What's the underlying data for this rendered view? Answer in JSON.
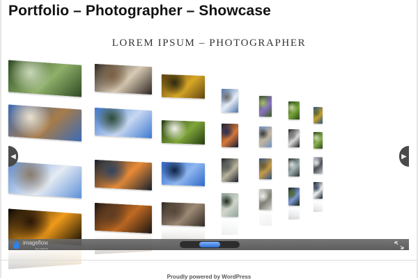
{
  "page": {
    "title": "Portfolio – Photographer – Showcase"
  },
  "gallery": {
    "heading": "LOREM IPSUM – PHOTOGRAPHER",
    "photos": [
      {
        "name": "photo-water-moss",
        "colors": [
          "#2e4a22",
          "#8fb06a",
          "#c9d7b9"
        ]
      },
      {
        "name": "photo-windmill-barn",
        "colors": [
          "#3a6bb8",
          "#a77c4a",
          "#e9e1cf"
        ]
      },
      {
        "name": "photo-winter-church-tower",
        "colors": [
          "#5d8fd7",
          "#e5ebf3",
          "#8a7b6a"
        ]
      },
      {
        "name": "photo-black-orange-circle",
        "colors": [
          "#050505",
          "#f09b1a",
          "#2a1708"
        ]
      },
      {
        "name": "photo-arch-window",
        "colors": [
          "#2b2420",
          "#d8cab3",
          "#7a5f42"
        ]
      },
      {
        "name": "photo-blue-sky-tree",
        "colors": [
          "#3d78d0",
          "#c7d8f1",
          "#2f4a35"
        ]
      },
      {
        "name": "photo-dusk-tree",
        "colors": [
          "#14202e",
          "#e98b37",
          "#31445f"
        ]
      },
      {
        "name": "photo-cafe-chairs",
        "colors": [
          "#191512",
          "#c06a22",
          "#5c3b24"
        ]
      },
      {
        "name": "photo-golden-leaves",
        "colors": [
          "#5f4310",
          "#d7a727",
          "#2d280f"
        ]
      },
      {
        "name": "photo-white-flower-green",
        "colors": [
          "#243b12",
          "#7fa63a",
          "#f2f2ea"
        ]
      },
      {
        "name": "photo-blue-sky-square",
        "colors": [
          "#2d67c8",
          "#8fb7ef",
          "#0f2240"
        ]
      },
      {
        "name": "photo-rock-wall",
        "colors": [
          "#2f2822",
          "#9d8a75",
          "#574639"
        ]
      },
      {
        "name": "photo-snow-branches",
        "colors": [
          "#4e72a8",
          "#e6edf6",
          "#6a6a6a"
        ]
      },
      {
        "name": "photo-night-orange-sky",
        "colors": [
          "#141b33",
          "#d7793a",
          "#2a2d55"
        ]
      },
      {
        "name": "photo-parasol-sunset",
        "colors": [
          "#1b2128",
          "#b9b39d",
          "#5a5e5c"
        ]
      },
      {
        "name": "photo-bare-branch-sky",
        "colors": [
          "#8fa39a",
          "#cfd6c9",
          "#1f2a1d"
        ]
      },
      {
        "name": "photo-purple-flowers",
        "colors": [
          "#3c5e19",
          "#8a73c6",
          "#a3c061"
        ]
      },
      {
        "name": "photo-stone-tower",
        "colors": [
          "#6e91c6",
          "#c2b59c",
          "#3c3a34"
        ]
      },
      {
        "name": "photo-reeds-autumn",
        "colors": [
          "#2f4f83",
          "#c59b46",
          "#6c5a2f"
        ]
      },
      {
        "name": "photo-white-birch",
        "colors": [
          "#d4d4d1",
          "#7f7f76",
          "#efefeb"
        ]
      },
      {
        "name": "photo-green-meadow",
        "colors": [
          "#2c4718",
          "#76a53a",
          "#cbd7a2"
        ]
      },
      {
        "name": "photo-people-silhouettes",
        "colors": [
          "#1d1d1d",
          "#dbdbdb",
          "#7d7d7d"
        ]
      },
      {
        "name": "photo-hazy-valley",
        "colors": [
          "#2a3431",
          "#9dadae",
          "#dfe1df"
        ]
      },
      {
        "name": "photo-blue-flowers",
        "colors": [
          "#15220f",
          "#7e9ad9",
          "#536e28"
        ]
      },
      {
        "name": "photo-yellow-field",
        "colors": [
          "#25517f",
          "#c9a22d",
          "#5d6a2b"
        ]
      },
      {
        "name": "photo-green-foliage",
        "colors": [
          "#2b4517",
          "#8bb04f",
          "#cfdfb0"
        ]
      },
      {
        "name": "photo-misty-lamp",
        "colors": [
          "#c0c6cf",
          "#4c4f55",
          "#e6e8ec"
        ]
      },
      {
        "name": "photo-white-blossom-dark",
        "colors": [
          "#0e1a2b",
          "#f0f0f0",
          "#3a4e6b"
        ]
      }
    ]
  },
  "controls": {
    "logo_text": "imageflow",
    "logo_sub": "by cosimo"
  },
  "footer": {
    "text": "Proudly powered by WordPress"
  }
}
